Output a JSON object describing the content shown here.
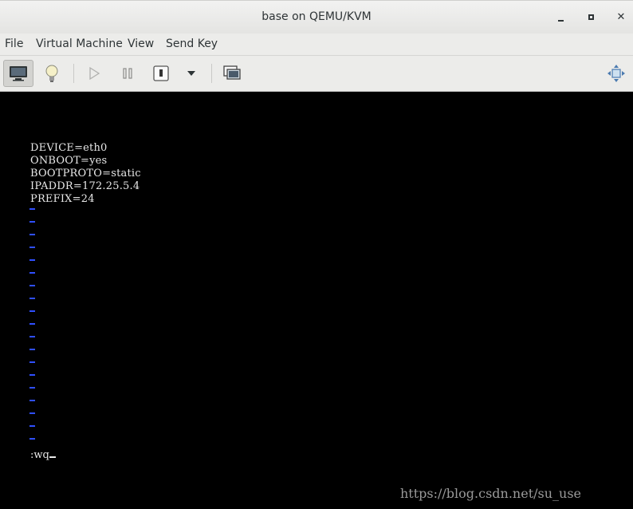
{
  "window": {
    "title": "base on QEMU/KVM"
  },
  "menu": {
    "items": [
      "File",
      "Virtual Machine",
      "View",
      "Send Key"
    ]
  },
  "toolbar": {
    "buttons": [
      "console-icon",
      "lightbulb-icon",
      "play-icon",
      "pause-icon",
      "power-icon",
      "dropdown-arrow-icon",
      "screenshot-icon",
      "fullscreen-icon"
    ]
  },
  "console": {
    "lines": [
      "DEVICE=eth0",
      "ONBOOT=yes",
      "BOOTPROTO=static",
      "IPADDR=172.25.5.4",
      "PREFIX=24"
    ],
    "command": ":wq",
    "watermark": "https://blog.csdn.net/su_use"
  },
  "colors": {
    "tilde": "#2f4fff",
    "text": "#e8e8e8"
  }
}
